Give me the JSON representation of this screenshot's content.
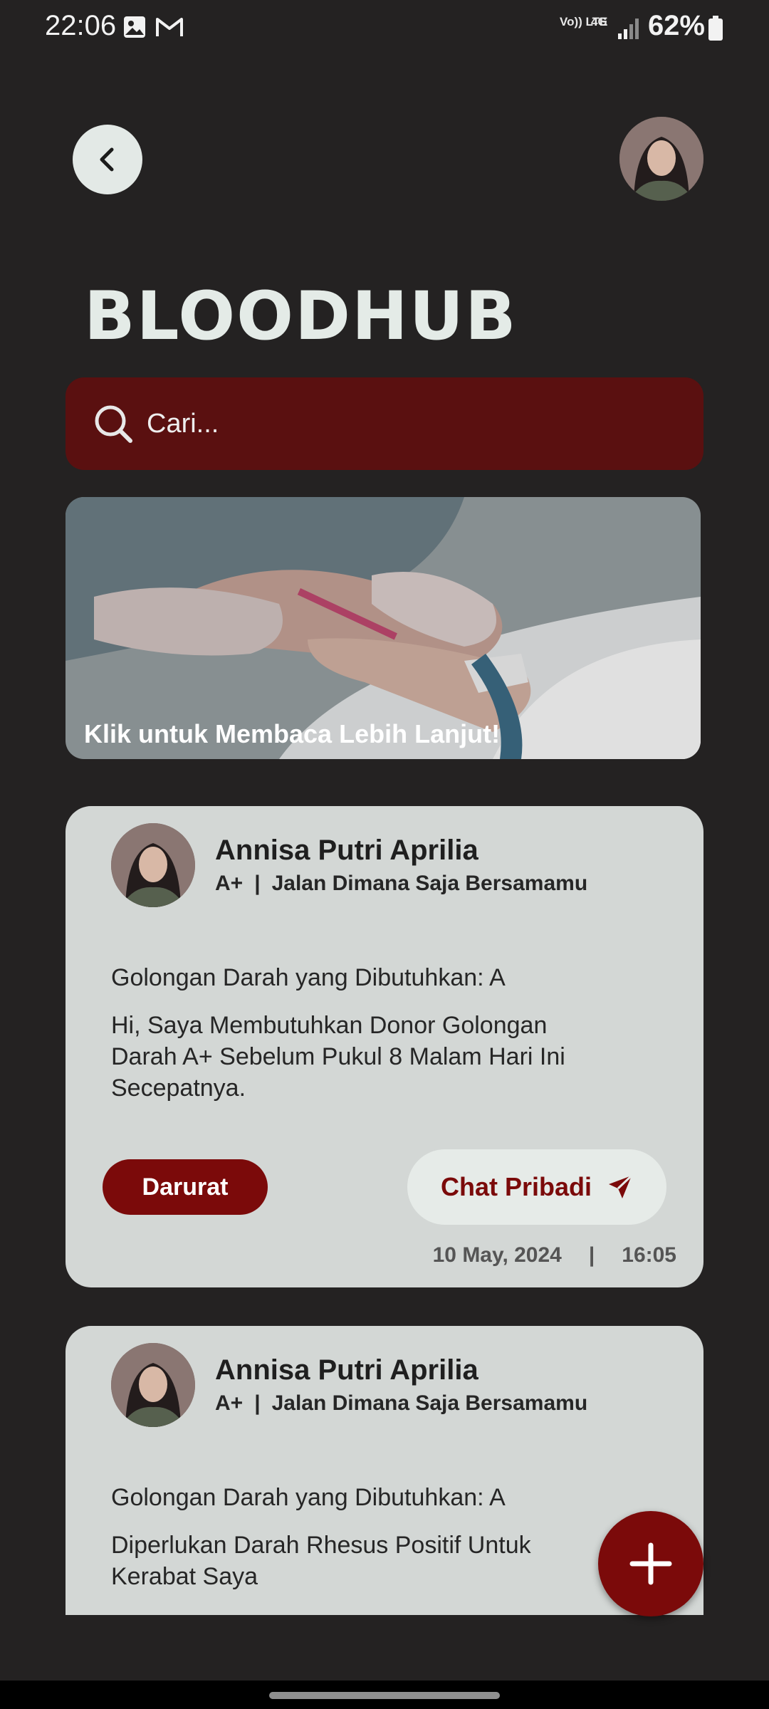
{
  "status_bar": {
    "time": "22:06",
    "battery": "62%",
    "volte": "Vo)) LTE",
    "network": "4G"
  },
  "app": {
    "title": "BLOODHUB"
  },
  "search": {
    "placeholder": "Cari..."
  },
  "banner": {
    "caption": "Klik untuk Membaca Lebih Lanjut!"
  },
  "posts": [
    {
      "name": "Annisa Putri Aprilia",
      "blood_type": "A+",
      "location": "Jalan Dimana Saja Bersamamu",
      "needed": "Golongan Darah yang Dibutuhkan: A",
      "message": "Hi, Saya Membutuhkan Donor Golongan Darah A+ Sebelum Pukul 8 Malam Hari Ini Secepatnya.",
      "badge": "Darurat",
      "chat_label": "Chat Pribadi",
      "date": "10 May, 2024",
      "time": "16:05"
    },
    {
      "name": "Annisa Putri Aprilia",
      "blood_type": "A+",
      "location": "Jalan Dimana Saja Bersamamu",
      "needed": "Golongan Darah yang Dibutuhkan: A",
      "message": "Diperlukan Darah Rhesus Positif Untuk Kerabat Saya"
    }
  ],
  "colors": {
    "background": "#242222",
    "accent": "#7b0a0a",
    "search_bg": "#5a1010",
    "card_bg": "#d3d7d5"
  }
}
